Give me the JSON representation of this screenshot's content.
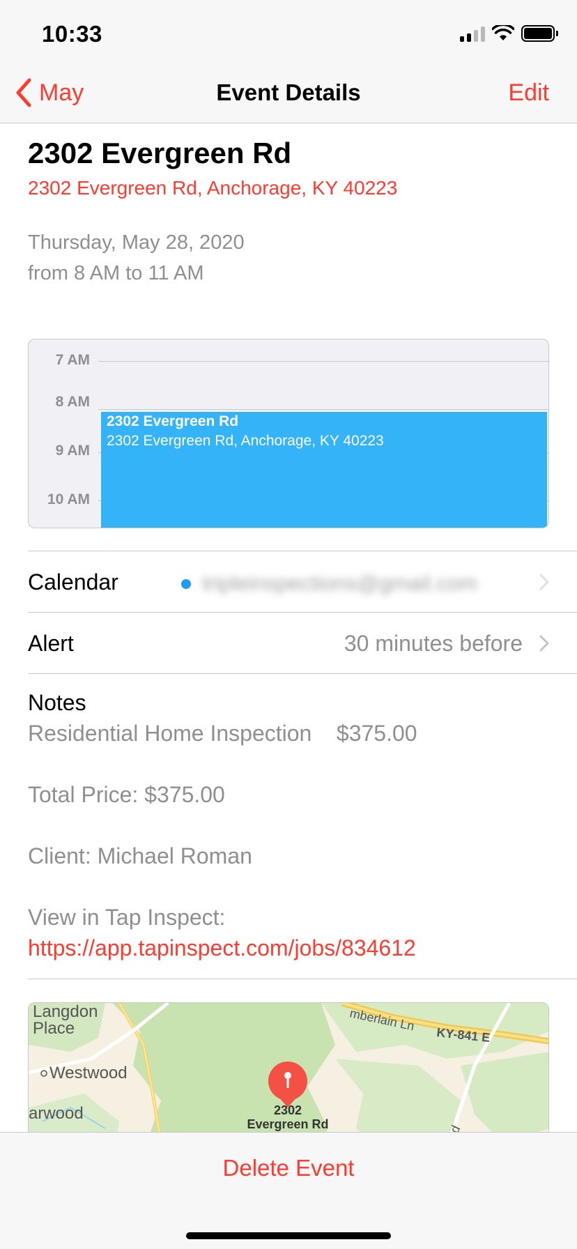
{
  "status_bar": {
    "time": "10:33"
  },
  "nav": {
    "back_label": "May",
    "title": "Event Details",
    "edit_label": "Edit"
  },
  "event": {
    "title": "2302 Evergreen Rd",
    "location": "2302 Evergreen Rd, Anchorage, KY 40223",
    "date": "Thursday, May 28, 2020",
    "time_range": "from 8 AM to 11 AM"
  },
  "day_preview": {
    "hours": [
      "7 AM",
      "8 AM",
      "9 AM",
      "10 AM"
    ],
    "event_title": "2302 Evergreen Rd",
    "event_location": "2302 Evergreen Rd, Anchorage, KY 40223",
    "event_color": "#34b3f8"
  },
  "rows": {
    "calendar_label": "Calendar",
    "calendar_value": "tripleinspections@gmail.com",
    "calendar_color": "#1e9bf5",
    "alert_label": "Alert",
    "alert_value": "30 minutes before"
  },
  "notes": {
    "label": "Notes",
    "line1": "Residential Home Inspection    $375.00",
    "line2": "Total Price: $375.00",
    "line3": "Client: Michael Roman",
    "line4": "View in Tap Inspect:",
    "link": "https://app.tapinspect.com/jobs/834612"
  },
  "map": {
    "labels": {
      "langdon_1": "Langdon",
      "langdon_2": "Place",
      "westwood": "Westwood",
      "arwood": "arwood",
      "chamberlain": "mberlain Ln",
      "ky841": "KY-841 E",
      "rd": "Rd",
      "pin_1": "2302",
      "pin_2": "Evergreen Rd"
    },
    "pin_color": "#f25143"
  },
  "toolbar": {
    "delete_label": "Delete Event"
  },
  "accent_color": "#ff3b30"
}
